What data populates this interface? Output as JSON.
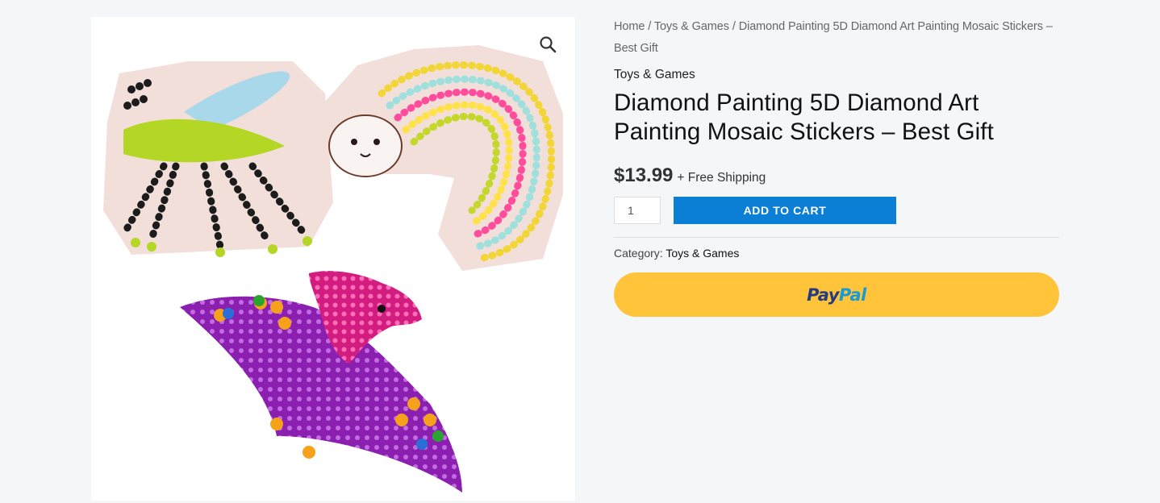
{
  "gallery": {
    "zoom_icon": "magnifier-icon",
    "image_alt": "Diamond painting mosaic stickers: dragonfly, cat with rainbow tail, pterodactyl"
  },
  "breadcrumb": {
    "home": "Home",
    "sep1": " / ",
    "category": "Toys & Games",
    "sep2": " / ",
    "current": "Diamond Painting 5D Diamond Art Painting Mosaic Stickers – Best Gift"
  },
  "product": {
    "category_label": "Toys & Games",
    "title": "Diamond Painting 5D Diamond Art Painting Mosaic Stickers – Best Gift",
    "price": "$13.99",
    "shipping": "+ Free Shipping",
    "quantity": "1",
    "add_to_cart": "ADD TO CART",
    "meta_label": "Category:",
    "meta_value": "Toys & Games"
  },
  "paypal": {
    "text_pay": "Pay",
    "text_pal": "Pal",
    "color_dark": "#253b80",
    "color_light": "#179bd7",
    "button_color": "#ffc439"
  },
  "colors": {
    "accent": "#0a7fd5",
    "background": "#f5f6f8"
  }
}
